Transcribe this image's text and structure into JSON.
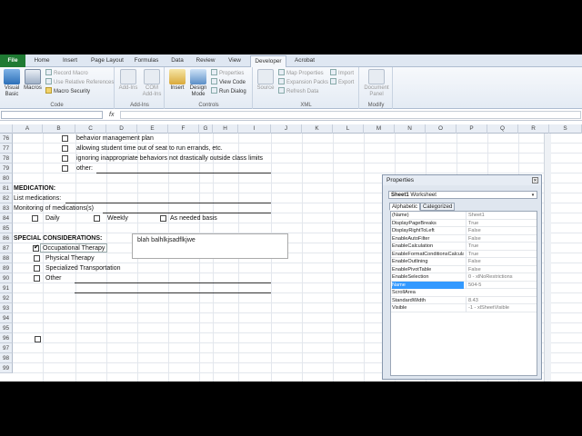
{
  "tabs": [
    "File",
    "Home",
    "Insert",
    "Page Layout",
    "Formulas",
    "Data",
    "Review",
    "View",
    "Developer",
    "Acrobat"
  ],
  "ribbon": {
    "code": {
      "label": "Code",
      "visual_basic": "Visual\nBasic",
      "macros": "Macros",
      "record_macro": "Record Macro",
      "use_relative": "Use Relative References",
      "macro_security": "Macro Security"
    },
    "addins": {
      "label": "Add-Ins",
      "addins": "Add-Ins",
      "com_addins": "COM\nAdd-Ins"
    },
    "controls": {
      "label": "Controls",
      "insert": "Insert",
      "design_mode": "Design\nMode",
      "properties": "Properties",
      "view_code": "View Code",
      "run_dialog": "Run Dialog"
    },
    "xml": {
      "label": "XML",
      "source": "Source",
      "map_properties": "Map Properties",
      "expansion_packs": "Expansion Packs",
      "refresh_data": "Refresh Data",
      "import": "Import",
      "export": "Export"
    },
    "modify": {
      "label": "Modify",
      "document_panel": "Document\nPanel"
    }
  },
  "formula_bar": {
    "fx": "fx",
    "name_box": "",
    "formula": ""
  },
  "columns": [
    "A",
    "B",
    "C",
    "D",
    "E",
    "F",
    "G",
    "H",
    "I",
    "J",
    "K",
    "L",
    "M",
    "N",
    "O",
    "P",
    "Q",
    "R",
    "S"
  ],
  "rows": [
    "76",
    "77",
    "78",
    "79",
    "80",
    "81",
    "82",
    "83",
    "84",
    "85",
    "86",
    "87",
    "88",
    "89",
    "90",
    "91",
    "92",
    "93",
    "94",
    "95",
    "96",
    "97",
    "98",
    "99"
  ],
  "cells": {
    "r76": "behavior management plan",
    "r77": "allowing student time out of seat to run errands, etc.",
    "r78": "ignoring inappropriate behaviors not drastically outside class limits",
    "r79": "other:",
    "r81": "MEDICATION:",
    "r82": "List medications:",
    "r83": "Monitoring of medications(s)",
    "daily": "Daily",
    "weekly": "Weekly",
    "as_needed": "As needed basis",
    "r86": "SPECIAL CONSIDERATIONS:",
    "occupational": "Occupational Therapy",
    "physical": "Physical Therapy",
    "transport": "Specialized Transportation",
    "other": "Other"
  },
  "textbox": "blah balhlkjsadflkjwe",
  "properties": {
    "title": "Properties",
    "object_name": "Sheet1",
    "object_type": "Worksheet",
    "tab_alphabetic": "Alphabetic",
    "tab_categorized": "Categorized",
    "rows": [
      {
        "k": "(Name)",
        "v": "Sheet1"
      },
      {
        "k": "DisplayPageBreaks",
        "v": "True"
      },
      {
        "k": "DisplayRightToLeft",
        "v": "False"
      },
      {
        "k": "EnableAutoFilter",
        "v": "False"
      },
      {
        "k": "EnableCalculation",
        "v": "True"
      },
      {
        "k": "EnableFormatConditionsCalcula",
        "v": "True"
      },
      {
        "k": "EnableOutlining",
        "v": "False"
      },
      {
        "k": "EnablePivotTable",
        "v": "False"
      },
      {
        "k": "EnableSelection",
        "v": "0 - xlNoRestrictions"
      },
      {
        "k": "Name",
        "v": "504-5"
      },
      {
        "k": "ScrollArea",
        "v": ""
      },
      {
        "k": "StandardWidth",
        "v": "8.43"
      },
      {
        "k": "Visible",
        "v": "-1 - xlSheetVisible"
      }
    ]
  },
  "colors": {
    "file_tab": "#1f7a33",
    "selected_row": "#3399ff",
    "ribbon_bg": "#e4ebf4"
  }
}
